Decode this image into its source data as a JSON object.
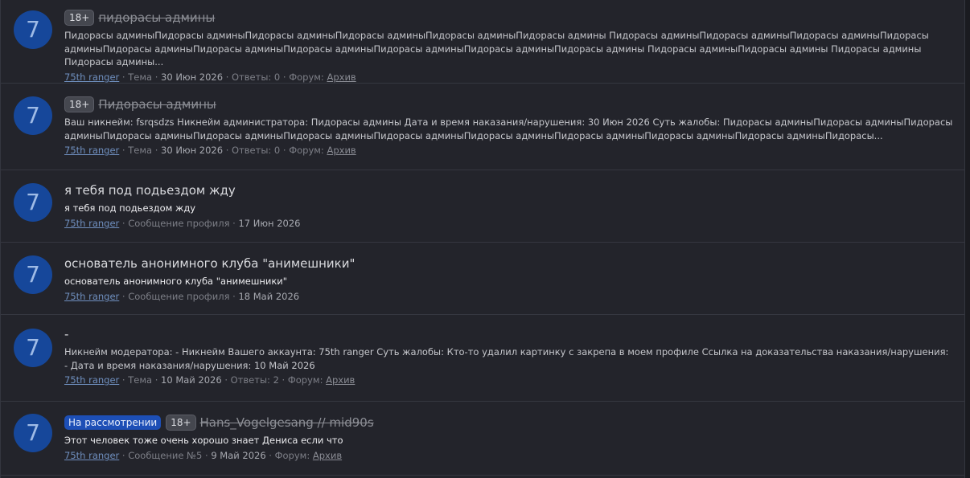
{
  "results": [
    {
      "avatar_letter": "7",
      "prefix_status": "",
      "prefix_age": "18+",
      "title": "пидорасы админы",
      "snippet": "Пидорасы админыПидорасы админыПидорасы админыПидорасы админыПидорасы админыПидорасы админы Пидорасы админыПидорасы админыПидорасы админыПидорасы админыПидорасы админыПидорасы админыПидорасы админыПидорасы админыПидорасы админыПидорасы админы Пидорасы админыПидорасы админы Пидорасы админы Пидорасы админы...",
      "author": "75th ranger",
      "type": "Тема",
      "date": "30 Июн 2026",
      "replies": "Ответы: 0",
      "forum_label": "Форум:",
      "forum": "Архив"
    },
    {
      "avatar_letter": "7",
      "prefix_status": "",
      "prefix_age": "18+",
      "title": "Пидорасы админы",
      "snippet": "Ваш никнейм: fsrqsdzs Никнейм администратора: Пидорасы админы Дата и время наказания/нарушения: 30 Июн 2026 Суть жалобы: Пидорасы админыПидорасы админыПидорасы админыПидорасы админыПидорасы админыПидорасы админыПидорасы админыПидорасы админыПидорасы админыПидорасы админыПидорасы админыПидорасы...",
      "author": "75th ranger",
      "type": "Тема",
      "date": "30 Июн 2026",
      "replies": "Ответы: 0",
      "forum_label": "Форум:",
      "forum": "Архив"
    },
    {
      "avatar_letter": "7",
      "prefix_status": "",
      "prefix_age": "",
      "title": "я тебя под подьездом жду",
      "snippet": "я тебя под подьездом жду",
      "author": "75th ranger",
      "type": "Сообщение профиля",
      "date": "17 Июн 2026",
      "replies": "",
      "forum_label": "",
      "forum": ""
    },
    {
      "avatar_letter": "7",
      "prefix_status": "",
      "prefix_age": "",
      "title": "основатель анонимного клуба \"анимешники\"",
      "snippet": "основатель анонимного клуба \"анимешники\"",
      "author": "75th ranger",
      "type": "Сообщение профиля",
      "date": "18 Май 2026",
      "replies": "",
      "forum_label": "",
      "forum": ""
    },
    {
      "avatar_letter": "7",
      "prefix_status": "",
      "prefix_age": "",
      "title": "-",
      "snippet": "Никнейм модератора: - Никнейм Вашего аккаунта: 75th ranger Суть жалобы: Кто-то удалил картинку с закрепа в моем профиле Ссылка на доказательства наказания/нарушения: - Дата и время наказания/нарушения: 10 Май 2026",
      "author": "75th ranger",
      "type": "Тема",
      "date": "10 Май 2026",
      "replies": "Ответы: 2",
      "forum_label": "Форум:",
      "forum": "Архив"
    },
    {
      "avatar_letter": "7",
      "prefix_status": "На рассмотрении",
      "prefix_age": "18+",
      "title": "Hans_Vogelgesang // mid90s",
      "snippet": "Этот человек тоже очень хорошо знает Дениса если что",
      "author": "75th ranger",
      "type": "Сообщение №5",
      "date": "9 Май 2026",
      "replies": "",
      "forum_label": "Форум:",
      "forum": "Архив"
    }
  ],
  "colors": {
    "background": "#1a1b20",
    "panel": "#23242b",
    "avatar": "#16479a",
    "status_badge": "#1d4fb6"
  }
}
